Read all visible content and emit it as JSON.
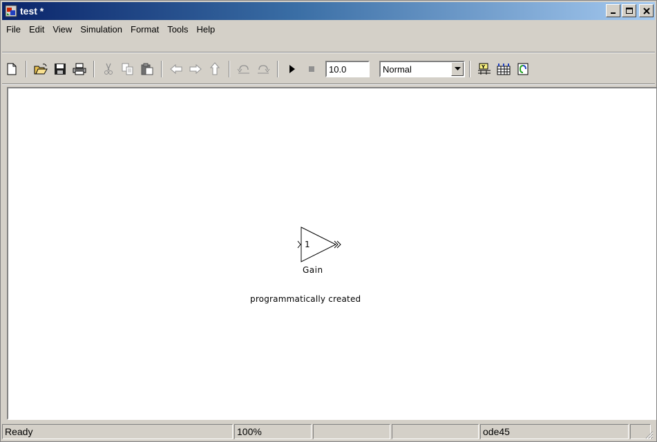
{
  "window": {
    "title": "test *",
    "controls": {
      "minimize": "_",
      "maximize": "□",
      "close": "x"
    }
  },
  "menu": {
    "items": [
      "File",
      "Edit",
      "View",
      "Simulation",
      "Format",
      "Tools",
      "Help"
    ]
  },
  "toolbar": {
    "icons": [
      "new-model-icon",
      "open-icon",
      "save-icon",
      "print-icon",
      "cut-icon",
      "copy-icon",
      "paste-icon",
      "back-icon",
      "forward-icon",
      "up-icon",
      "undo-icon",
      "redo-icon",
      "start-simulation-icon",
      "stop-simulation-icon",
      "library-browser-icon",
      "model-explorer-icon",
      "debug-icon"
    ],
    "stop_time": "10.0",
    "sim_mode": "Normal"
  },
  "canvas": {
    "gain_value": "1",
    "gain_label": "Gain",
    "annotation": "programmatically created"
  },
  "status": {
    "state": "Ready",
    "zoom": "100%",
    "solver": "ode45"
  }
}
